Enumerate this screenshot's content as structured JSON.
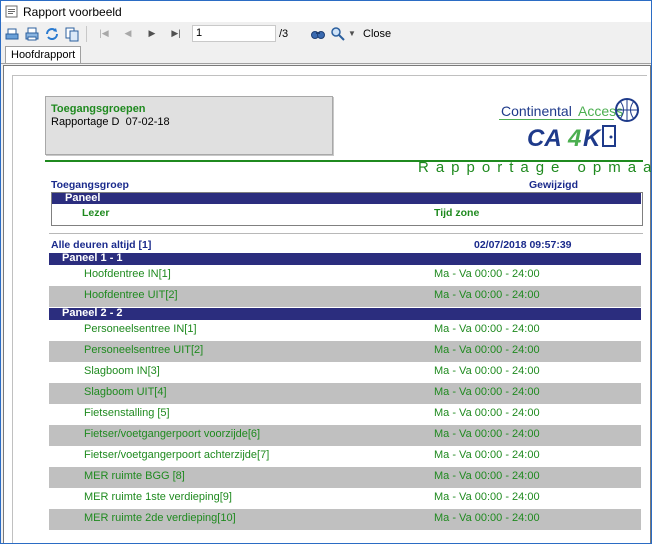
{
  "window": {
    "title": "Rapport voorbeeld"
  },
  "toolbar": {
    "current_page": "1",
    "total_pages": "/3",
    "close_label": "Close",
    "icons": [
      "print-setup-icon",
      "print-icon",
      "refresh-icon",
      "export-icon",
      "first-page-icon",
      "previous-page-icon",
      "next-page-icon",
      "last-page-icon",
      "search-icon",
      "zoom-icon",
      "dropdown-arrow-icon"
    ]
  },
  "tabs": [
    "Hoofdrapport"
  ],
  "report": {
    "header": {
      "title": "Toegangsgroepen",
      "subtitle_prefix": "Rapportage D",
      "date": "07-02-18"
    },
    "logo": {
      "top": "Continental Access",
      "brand": "CA4K"
    },
    "title": "Rapportage opmaak",
    "columns": {
      "group": "Toegangsgroep",
      "changed": "Gewijzigd",
      "panel": "Paneel",
      "reader": "Lezer",
      "time_zone": "Tijd zone"
    },
    "group": {
      "name": "Alle deuren altijd [1]",
      "changed": "02/07/2018 09:57:39"
    },
    "panels": [
      {
        "name": "Paneel 1 - 1",
        "readers": [
          {
            "door": "Hoofdentree IN[1]",
            "zone": "Ma - Va 00:00 - 24:00"
          },
          {
            "door": "Hoofdentree UIT[2]",
            "zone": "Ma - Va 00:00 - 24:00"
          }
        ]
      },
      {
        "name": "Paneel 2 - 2",
        "readers": [
          {
            "door": "Personeelsentree IN[1]",
            "zone": "Ma - Va 00:00 - 24:00"
          },
          {
            "door": "Personeelsentree UIT[2]",
            "zone": "Ma - Va 00:00 - 24:00"
          },
          {
            "door": "Slagboom IN[3]",
            "zone": "Ma - Va 00:00 - 24:00"
          },
          {
            "door": "Slagboom UIT[4]",
            "zone": "Ma - Va 00:00 - 24:00"
          },
          {
            "door": "Fietsenstalling [5]",
            "zone": "Ma - Va 00:00 - 24:00"
          },
          {
            "door": "Fietser/voetgangerpoort voorzijde[6]",
            "zone": "Ma - Va 00:00 - 24:00"
          },
          {
            "door": "Fietser/voetgangerpoort achterzijde[7]",
            "zone": "Ma - Va 00:00 - 24:00"
          },
          {
            "door": "MER ruimte BGG [8]",
            "zone": "Ma - Va 00:00 - 24:00"
          },
          {
            "door": "MER ruimte 1ste verdieping[9]",
            "zone": "Ma - Va 00:00 - 24:00"
          },
          {
            "door": "MER ruimte 2de verdieping[10]",
            "zone": "Ma - Va 00:00 - 24:00"
          }
        ]
      }
    ]
  },
  "colors": {
    "green": "#1f8a1f",
    "navy": "#2b2d7e",
    "grey_row": "#c0c0c0",
    "window_border": "#2b6cc4"
  }
}
